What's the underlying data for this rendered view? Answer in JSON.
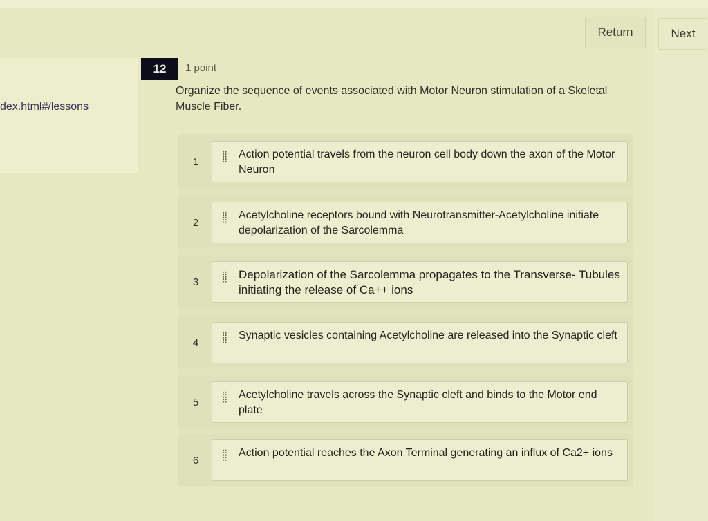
{
  "header": {
    "return_label": "Return",
    "next_label": "Next"
  },
  "sidebar": {
    "url_text": "dex.html#/lessons"
  },
  "question": {
    "number": "12",
    "points": "1 point",
    "prompt": "Organize the sequence of events associated with Motor Neuron stimulation of a Skeletal Muscle Fiber."
  },
  "items": [
    {
      "rank": "1",
      "text": "Action potential travels from the neuron cell body down the axon of the Motor Neuron"
    },
    {
      "rank": "2",
      "text": "Acetylcholine receptors bound with Neurotransmitter-Acetylcholine initiate depolarization of the Sarcolemma"
    },
    {
      "rank": "3",
      "text": "Depolarization of the Sarcolemma propagates to the Transverse- Tubules initiating the release of Ca++ ions"
    },
    {
      "rank": "4",
      "text": "Synaptic vesicles containing Acetylcholine are released into the Synaptic cleft"
    },
    {
      "rank": "5",
      "text": "Acetylcholine travels across the Synaptic cleft and binds to the Motor end plate"
    },
    {
      "rank": "6",
      "text": "Action potential reaches the Axon Terminal generating an influx of Ca2+ ions"
    }
  ],
  "icons": {
    "drag_handle": "drag-handle-icon"
  },
  "colors": {
    "background": "#e6e8c2",
    "question_badge": "#0c0c1a",
    "link": "#3b2f5a"
  }
}
